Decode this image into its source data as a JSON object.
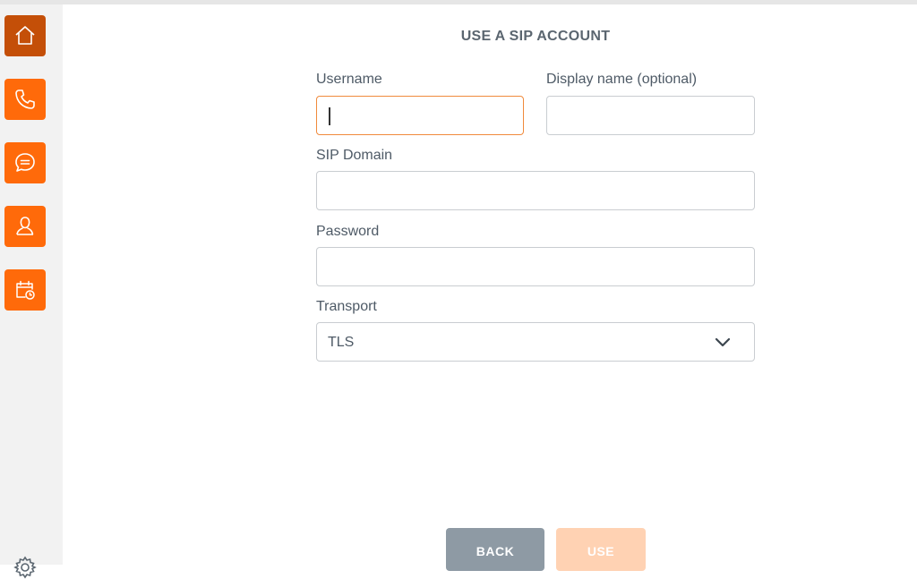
{
  "sidebar": {
    "items": [
      {
        "name": "home",
        "icon": "home-icon",
        "active": true
      },
      {
        "name": "calls",
        "icon": "phone-icon",
        "active": false
      },
      {
        "name": "chat",
        "icon": "chat-icon",
        "active": false
      },
      {
        "name": "contacts",
        "icon": "person-icon",
        "active": false
      },
      {
        "name": "history",
        "icon": "calendar-clock-icon",
        "active": false
      }
    ],
    "settings_icon": "gear-icon"
  },
  "form": {
    "title": "USE A SIP ACCOUNT",
    "username": {
      "label": "Username",
      "value": ""
    },
    "display_name": {
      "label": "Display name (optional)",
      "value": ""
    },
    "sip_domain": {
      "label": "SIP Domain",
      "value": ""
    },
    "password": {
      "label": "Password",
      "value": ""
    },
    "transport": {
      "label": "Transport",
      "value": "TLS"
    }
  },
  "buttons": {
    "back": "BACK",
    "use": "USE"
  },
  "colors": {
    "accent": "#ff6a0a",
    "accent_active": "#c44f08",
    "back_button": "#8e9aa4",
    "use_button_disabled": "#ffd2b3"
  }
}
